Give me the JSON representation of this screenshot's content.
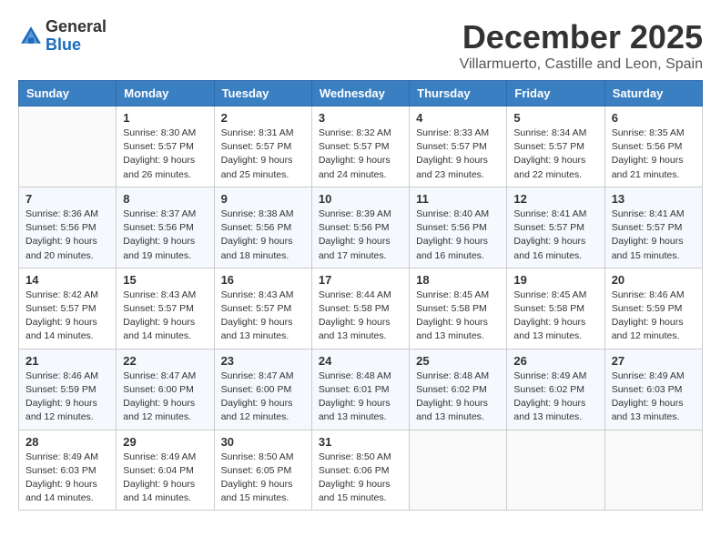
{
  "header": {
    "logo_general": "General",
    "logo_blue": "Blue",
    "title": "December 2025",
    "subtitle": "Villarmuerto, Castille and Leon, Spain"
  },
  "weekdays": [
    "Sunday",
    "Monday",
    "Tuesday",
    "Wednesday",
    "Thursday",
    "Friday",
    "Saturday"
  ],
  "weeks": [
    [
      {
        "day": "",
        "sunrise": "",
        "sunset": "",
        "daylight": ""
      },
      {
        "day": "1",
        "sunrise": "Sunrise: 8:30 AM",
        "sunset": "Sunset: 5:57 PM",
        "daylight": "Daylight: 9 hours and 26 minutes."
      },
      {
        "day": "2",
        "sunrise": "Sunrise: 8:31 AM",
        "sunset": "Sunset: 5:57 PM",
        "daylight": "Daylight: 9 hours and 25 minutes."
      },
      {
        "day": "3",
        "sunrise": "Sunrise: 8:32 AM",
        "sunset": "Sunset: 5:57 PM",
        "daylight": "Daylight: 9 hours and 24 minutes."
      },
      {
        "day": "4",
        "sunrise": "Sunrise: 8:33 AM",
        "sunset": "Sunset: 5:57 PM",
        "daylight": "Daylight: 9 hours and 23 minutes."
      },
      {
        "day": "5",
        "sunrise": "Sunrise: 8:34 AM",
        "sunset": "Sunset: 5:57 PM",
        "daylight": "Daylight: 9 hours and 22 minutes."
      },
      {
        "day": "6",
        "sunrise": "Sunrise: 8:35 AM",
        "sunset": "Sunset: 5:56 PM",
        "daylight": "Daylight: 9 hours and 21 minutes."
      }
    ],
    [
      {
        "day": "7",
        "sunrise": "Sunrise: 8:36 AM",
        "sunset": "Sunset: 5:56 PM",
        "daylight": "Daylight: 9 hours and 20 minutes."
      },
      {
        "day": "8",
        "sunrise": "Sunrise: 8:37 AM",
        "sunset": "Sunset: 5:56 PM",
        "daylight": "Daylight: 9 hours and 19 minutes."
      },
      {
        "day": "9",
        "sunrise": "Sunrise: 8:38 AM",
        "sunset": "Sunset: 5:56 PM",
        "daylight": "Daylight: 9 hours and 18 minutes."
      },
      {
        "day": "10",
        "sunrise": "Sunrise: 8:39 AM",
        "sunset": "Sunset: 5:56 PM",
        "daylight": "Daylight: 9 hours and 17 minutes."
      },
      {
        "day": "11",
        "sunrise": "Sunrise: 8:40 AM",
        "sunset": "Sunset: 5:56 PM",
        "daylight": "Daylight: 9 hours and 16 minutes."
      },
      {
        "day": "12",
        "sunrise": "Sunrise: 8:41 AM",
        "sunset": "Sunset: 5:57 PM",
        "daylight": "Daylight: 9 hours and 16 minutes."
      },
      {
        "day": "13",
        "sunrise": "Sunrise: 8:41 AM",
        "sunset": "Sunset: 5:57 PM",
        "daylight": "Daylight: 9 hours and 15 minutes."
      }
    ],
    [
      {
        "day": "14",
        "sunrise": "Sunrise: 8:42 AM",
        "sunset": "Sunset: 5:57 PM",
        "daylight": "Daylight: 9 hours and 14 minutes."
      },
      {
        "day": "15",
        "sunrise": "Sunrise: 8:43 AM",
        "sunset": "Sunset: 5:57 PM",
        "daylight": "Daylight: 9 hours and 14 minutes."
      },
      {
        "day": "16",
        "sunrise": "Sunrise: 8:43 AM",
        "sunset": "Sunset: 5:57 PM",
        "daylight": "Daylight: 9 hours and 13 minutes."
      },
      {
        "day": "17",
        "sunrise": "Sunrise: 8:44 AM",
        "sunset": "Sunset: 5:58 PM",
        "daylight": "Daylight: 9 hours and 13 minutes."
      },
      {
        "day": "18",
        "sunrise": "Sunrise: 8:45 AM",
        "sunset": "Sunset: 5:58 PM",
        "daylight": "Daylight: 9 hours and 13 minutes."
      },
      {
        "day": "19",
        "sunrise": "Sunrise: 8:45 AM",
        "sunset": "Sunset: 5:58 PM",
        "daylight": "Daylight: 9 hours and 13 minutes."
      },
      {
        "day": "20",
        "sunrise": "Sunrise: 8:46 AM",
        "sunset": "Sunset: 5:59 PM",
        "daylight": "Daylight: 9 hours and 12 minutes."
      }
    ],
    [
      {
        "day": "21",
        "sunrise": "Sunrise: 8:46 AM",
        "sunset": "Sunset: 5:59 PM",
        "daylight": "Daylight: 9 hours and 12 minutes."
      },
      {
        "day": "22",
        "sunrise": "Sunrise: 8:47 AM",
        "sunset": "Sunset: 6:00 PM",
        "daylight": "Daylight: 9 hours and 12 minutes."
      },
      {
        "day": "23",
        "sunrise": "Sunrise: 8:47 AM",
        "sunset": "Sunset: 6:00 PM",
        "daylight": "Daylight: 9 hours and 12 minutes."
      },
      {
        "day": "24",
        "sunrise": "Sunrise: 8:48 AM",
        "sunset": "Sunset: 6:01 PM",
        "daylight": "Daylight: 9 hours and 13 minutes."
      },
      {
        "day": "25",
        "sunrise": "Sunrise: 8:48 AM",
        "sunset": "Sunset: 6:02 PM",
        "daylight": "Daylight: 9 hours and 13 minutes."
      },
      {
        "day": "26",
        "sunrise": "Sunrise: 8:49 AM",
        "sunset": "Sunset: 6:02 PM",
        "daylight": "Daylight: 9 hours and 13 minutes."
      },
      {
        "day": "27",
        "sunrise": "Sunrise: 8:49 AM",
        "sunset": "Sunset: 6:03 PM",
        "daylight": "Daylight: 9 hours and 13 minutes."
      }
    ],
    [
      {
        "day": "28",
        "sunrise": "Sunrise: 8:49 AM",
        "sunset": "Sunset: 6:03 PM",
        "daylight": "Daylight: 9 hours and 14 minutes."
      },
      {
        "day": "29",
        "sunrise": "Sunrise: 8:49 AM",
        "sunset": "Sunset: 6:04 PM",
        "daylight": "Daylight: 9 hours and 14 minutes."
      },
      {
        "day": "30",
        "sunrise": "Sunrise: 8:50 AM",
        "sunset": "Sunset: 6:05 PM",
        "daylight": "Daylight: 9 hours and 15 minutes."
      },
      {
        "day": "31",
        "sunrise": "Sunrise: 8:50 AM",
        "sunset": "Sunset: 6:06 PM",
        "daylight": "Daylight: 9 hours and 15 minutes."
      },
      {
        "day": "",
        "sunrise": "",
        "sunset": "",
        "daylight": ""
      },
      {
        "day": "",
        "sunrise": "",
        "sunset": "",
        "daylight": ""
      },
      {
        "day": "",
        "sunrise": "",
        "sunset": "",
        "daylight": ""
      }
    ]
  ]
}
